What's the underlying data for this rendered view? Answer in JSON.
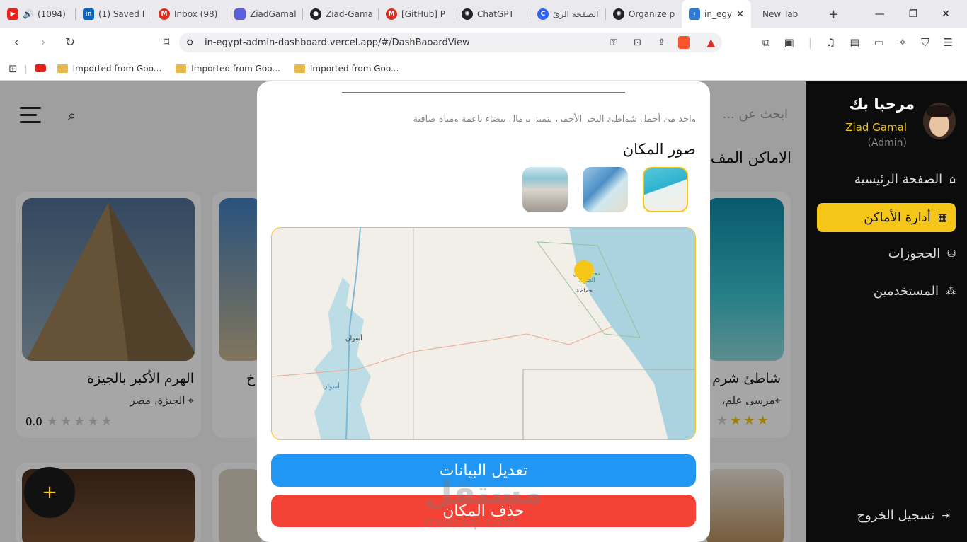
{
  "tabs": [
    {
      "label": "(1094)",
      "color": "#e62117"
    },
    {
      "label": "(1) Saved I",
      "color": "#0a66c2"
    },
    {
      "label": "Inbox (98)",
      "color": "#d93025"
    },
    {
      "label": "ZiadGamal",
      "color": "#5b5fdc"
    },
    {
      "label": "Ziad-Gama",
      "color": "#222222"
    },
    {
      "label": "[GitHub] P",
      "color": "#d93025"
    },
    {
      "label": "ChatGPT",
      "color": "#222222"
    },
    {
      "label": "الصفحة الرئ",
      "color": "#2d62ff"
    },
    {
      "label": "Organize p",
      "color": "#222222"
    },
    {
      "label": "in_egy",
      "color": "#2d7bd6"
    },
    {
      "label": "New Tab",
      "color": "#999999"
    }
  ],
  "url": "in-egypt-admin-dashboard.vercel.app/#/DashBaoardView",
  "bookmarks": [
    "Imported from Goo...",
    "Imported from Goo...",
    "Imported from Goo..."
  ],
  "header": {
    "search_placeholder": "ابحث عن ...",
    "section_title": "الاماكن المف"
  },
  "sidebar": {
    "welcome": "مرحبا بك",
    "user_name": "Ziad Gamal",
    "role": "(Admin)",
    "items": [
      "الصفحة الرئيسية",
      "أدارة الأماكن",
      "الحجوزات",
      "المستخدمين"
    ],
    "logout": "تسجيل الخروج",
    "accent": "#f5c518"
  },
  "cards": [
    {
      "title": "الهرم الأكبر بالجيزة",
      "location": "الجيزة، مصر",
      "rating": "0.0"
    },
    {
      "title": "خ"
    },
    {
      "title": "شاطئ شرم",
      "location": "مرسى علم،"
    }
  ],
  "fab": "+",
  "modal": {
    "desc": "واحد من أجمل شواطئ البحر الأحمر، يتميز برمال بيضاء ناعمة ومياه صافية",
    "photos_title": "صور المكان",
    "map_labels": {
      "aswan1": "أسوان",
      "aswan2": "أسوان",
      "place": "محمية وادي الجمال",
      "place2": "حماطة"
    },
    "edit_button": "تعديل البيانات",
    "delete_button": "حذف المكان",
    "edit_color": "#2196f3",
    "delete_color": "#f44336"
  },
  "watermark": {
    "text": "مستقل",
    "sub": "mostaql.com"
  }
}
